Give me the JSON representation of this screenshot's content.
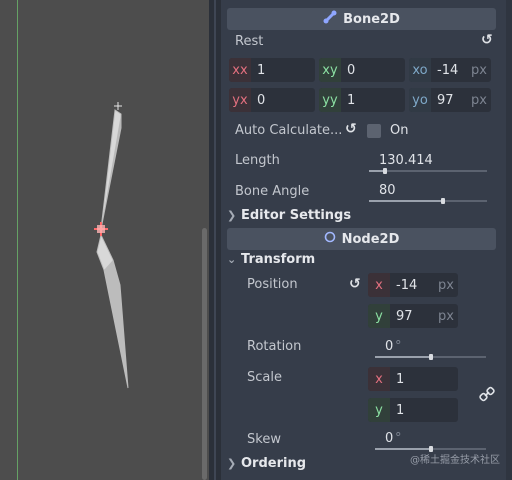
{
  "bone2d": {
    "title": "Bone2D",
    "rest_label": "Rest",
    "rest": {
      "xx": {
        "label": "xx",
        "value": "1"
      },
      "xy": {
        "label": "xy",
        "value": "0"
      },
      "xo": {
        "label": "xo",
        "value": "-14",
        "unit": "px"
      },
      "yx": {
        "label": "yx",
        "value": "0"
      },
      "yy": {
        "label": "yy",
        "value": "1"
      },
      "yo": {
        "label": "yo",
        "value": "97",
        "unit": "px"
      }
    },
    "auto_calc_label": "Auto Calculate...",
    "auto_calc_value": "On",
    "length_label": "Length",
    "length_value": "130.414",
    "bone_angle_label": "Bone Angle",
    "bone_angle_value": "80",
    "editor_settings_label": "Editor Settings"
  },
  "node2d": {
    "title": "Node2D",
    "transform_label": "Transform",
    "position_label": "Position",
    "position": {
      "x": {
        "label": "x",
        "value": "-14",
        "unit": "px"
      },
      "y": {
        "label": "y",
        "value": "97",
        "unit": "px"
      }
    },
    "rotation_label": "Rotation",
    "rotation_value": "0",
    "rotation_unit": "°",
    "scale_label": "Scale",
    "scale": {
      "x": {
        "label": "x",
        "value": "1"
      },
      "y": {
        "label": "y",
        "value": "1"
      }
    },
    "skew_label": "Skew",
    "skew_value": "0",
    "skew_unit": "°",
    "ordering_label": "Ordering"
  },
  "watermark": "@稀土掘金技术社区",
  "icons": {
    "bone": "bone-icon",
    "node": "node-circle-icon",
    "revert": "revert-icon",
    "link": "link-icon",
    "chevron_right": "chevron-right-icon",
    "chevron_down": "chevron-down-icon"
  },
  "colors": {
    "axis_red": "#e4707f",
    "axis_green": "#8be0a2",
    "header_bg": "#4a5260",
    "panel_bg": "#363d4a",
    "viewport_bg": "#4d4d4d"
  }
}
